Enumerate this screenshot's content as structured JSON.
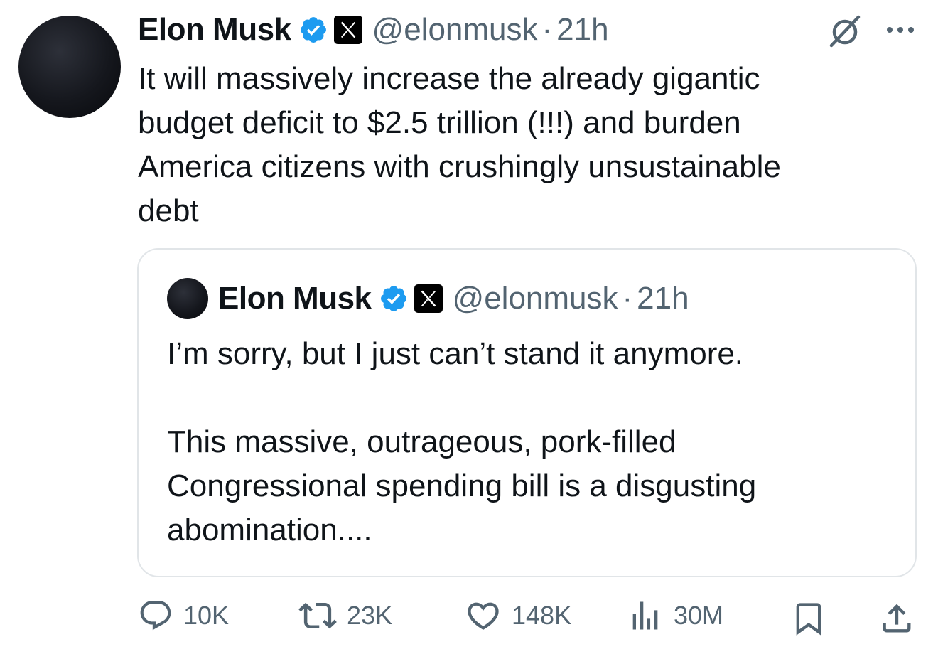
{
  "tweet": {
    "author_name": "Elon Musk",
    "handle": "@elonmusk",
    "separator": "·",
    "time": "21h",
    "text_lines": [
      "It will massively increase the already gigantic",
      "budget deficit to $2.5 trillion (!!!) and burden",
      "America citizens with crushingly unsustainable",
      "debt"
    ]
  },
  "quoted_tweet": {
    "author_name": "Elon Musk",
    "handle": "@elonmusk",
    "separator": "·",
    "time": "21h",
    "paragraph1": "I’m sorry, but I just can’t stand it anymore.",
    "paragraph2_lines": [
      "This massive, outrageous, pork-filled",
      "Congressional spending bill is a disgusting",
      "abomination...."
    ]
  },
  "actions": {
    "replies": "10K",
    "reposts": "23K",
    "likes": "148K",
    "views": "30M"
  },
  "icons": {
    "verified": "verified-badge-icon",
    "affiliate": "x-logo-icon",
    "grok": "grok-icon",
    "more": "more-icon",
    "reply": "reply-icon",
    "repost": "repost-icon",
    "like": "heart-icon",
    "views": "analytics-icon",
    "bookmark": "bookmark-icon",
    "share": "share-icon"
  },
  "colors": {
    "text": "#0f1419",
    "secondary": "#536471",
    "verified_blue": "#1d9bf0",
    "border": "#e1e5e8"
  }
}
